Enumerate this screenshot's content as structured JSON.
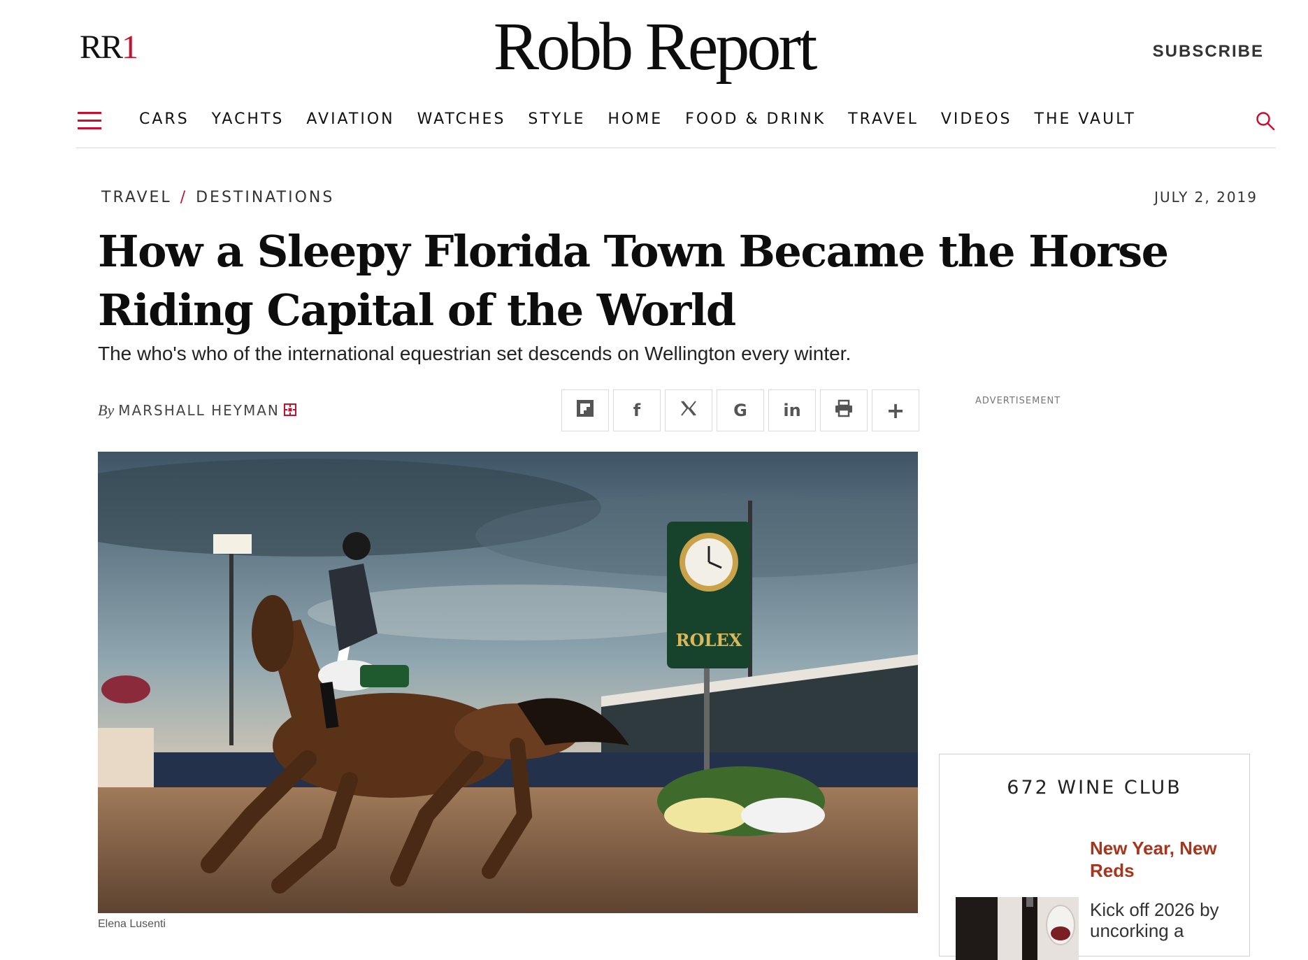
{
  "header": {
    "rr1_logo_prefix": "RR",
    "rr1_logo_suffix": "1",
    "brand": "Robb Report",
    "subscribe": "SUBSCRIBE"
  },
  "nav": {
    "items": [
      "CARS",
      "YACHTS",
      "AVIATION",
      "WATCHES",
      "STYLE",
      "HOME",
      "FOOD & DRINK",
      "TRAVEL",
      "VIDEOS",
      "THE VAULT"
    ]
  },
  "article": {
    "breadcrumb": [
      "TRAVEL",
      "DESTINATIONS"
    ],
    "breadcrumb_separator": "/",
    "date": "JULY 2, 2019",
    "headline": "How a Sleepy Florida Town Became the Horse Riding Capital of the World",
    "dek": "The who's who of the international equestrian set descends on Wellington every winter.",
    "byline_prefix": "By",
    "author": "MARSHALL HEYMAN",
    "image_credit": "Elena Lusenti",
    "image_signage_text": "ROLEX"
  },
  "share": {
    "buttons": [
      "flipboard-icon",
      "facebook-icon",
      "x-icon",
      "google-icon",
      "linkedin-icon",
      "print-icon",
      "plus-icon"
    ],
    "glyphs": {
      "facebook": "f",
      "google": "G",
      "linkedin": "in",
      "plus": "+"
    }
  },
  "sidebar": {
    "ad_label": "ADVERTISEMENT",
    "wine_club": {
      "title": "672 WINE CLUB",
      "headline": "New Year, New Reds",
      "text": "Kick off 2026 by uncorking a"
    }
  },
  "colors": {
    "accent_red": "#c8102e",
    "promo_brown": "#a8341b"
  }
}
